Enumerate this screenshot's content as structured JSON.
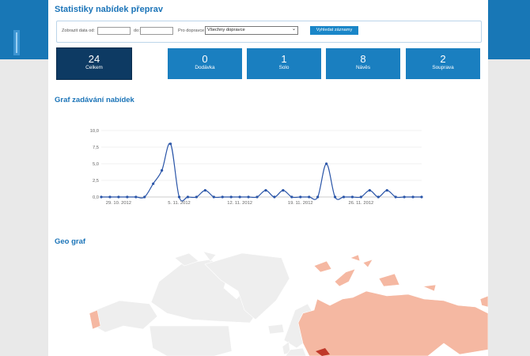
{
  "header": {
    "title": "Statistiky nabídek přeprav"
  },
  "filter": {
    "date_from_label": "Zobrazit data od:",
    "date_from_value": "",
    "date_to_label": "do:",
    "date_to_value": "",
    "carrier_label": "Pro dopravce",
    "carrier_selected": "Všechny dopravce",
    "search_button": "Vyhledat záznamy"
  },
  "stats": [
    {
      "value": "24",
      "label": "Celkem",
      "active": true
    },
    {
      "value": "0",
      "label": "Dodávka"
    },
    {
      "value": "1",
      "label": "Solo"
    },
    {
      "value": "8",
      "label": "Návěs"
    },
    {
      "value": "2",
      "label": "Souprava"
    }
  ],
  "chart_section_title": "Graf zadávání nabídek",
  "geo_section_title": "Geo graf",
  "colors": {
    "accent": "#1b74b8",
    "band": "#1877b6",
    "active_tile": "#0d3a63",
    "tile": "#1a7fc0",
    "line": "#2a55a8",
    "map_land": "#eeeeee",
    "map_highlight": "#f5b8a2",
    "map_strong": "#c0392b"
  },
  "chart_data": {
    "type": "line",
    "title": "",
    "xlabel": "",
    "ylabel": "",
    "ylim": [
      0,
      10
    ],
    "y_ticks": [
      "0,0",
      "2,5",
      "5,0",
      "7,5",
      "10,0"
    ],
    "x_tick_labels": [
      {
        "index": 2,
        "label": "29. 10. 2012"
      },
      {
        "index": 9,
        "label": "5. 11. 2012"
      },
      {
        "index": 16,
        "label": "12. 11. 2012"
      },
      {
        "index": 23,
        "label": "19. 11. 2012"
      },
      {
        "index": 30,
        "label": "26. 11. 2012"
      }
    ],
    "values": [
      0,
      0,
      0,
      0,
      0,
      0,
      2,
      4,
      8,
      0,
      0,
      0,
      1,
      0,
      0,
      0,
      0,
      0,
      0,
      1,
      0,
      1,
      0,
      0,
      0,
      0,
      5,
      0,
      0,
      0,
      0,
      1,
      0,
      1,
      0,
      0,
      0,
      0
    ]
  }
}
